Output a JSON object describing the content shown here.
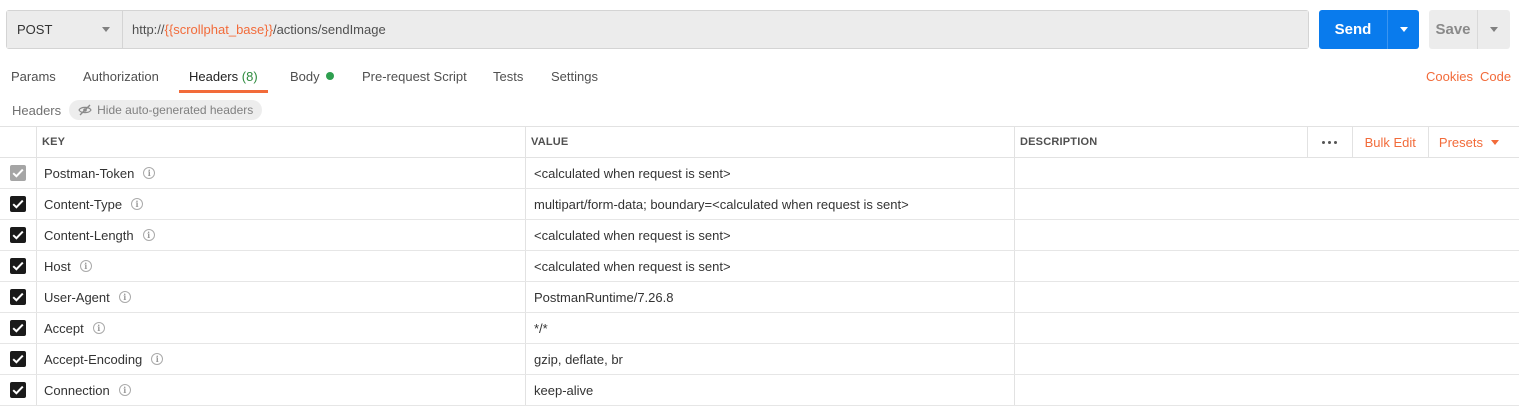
{
  "request": {
    "method": "POST",
    "url_prefix": "http://",
    "url_variable": "{{scrollphat_base}}",
    "url_suffix": "/actions/sendImage"
  },
  "buttons": {
    "send": "Send",
    "save": "Save"
  },
  "tabs": [
    {
      "label": "Params"
    },
    {
      "label": "Authorization"
    },
    {
      "label": "Headers",
      "count": "(8)"
    },
    {
      "label": "Body"
    },
    {
      "label": "Pre-request Script"
    },
    {
      "label": "Tests"
    },
    {
      "label": "Settings"
    }
  ],
  "links": {
    "cookies": "Cookies",
    "code": "Code"
  },
  "headers_section": {
    "title": "Headers",
    "hide_button": "Hide auto-generated headers"
  },
  "table": {
    "columns": {
      "key": "KEY",
      "value": "VALUE",
      "description": "DESCRIPTION"
    },
    "actions": {
      "bulk_edit": "Bulk Edit",
      "presets": "Presets"
    },
    "rows": [
      {
        "key": "Postman-Token",
        "value": "<calculated when request is sent>",
        "checked": true,
        "disabled": true
      },
      {
        "key": "Content-Type",
        "value": "multipart/form-data; boundary=<calculated when request is sent>",
        "checked": true
      },
      {
        "key": "Content-Length",
        "value": "<calculated when request is sent>",
        "checked": true
      },
      {
        "key": "Host",
        "value": "<calculated when request is sent>",
        "checked": true
      },
      {
        "key": "User-Agent",
        "value": "PostmanRuntime/7.26.8",
        "checked": true
      },
      {
        "key": "Accept",
        "value": "*/*",
        "checked": true
      },
      {
        "key": "Accept-Encoding",
        "value": "gzip, deflate, br",
        "checked": true
      },
      {
        "key": "Connection",
        "value": "keep-alive",
        "checked": true
      }
    ]
  },
  "colors": {
    "accent": "#f26b3a",
    "send": "#097bed",
    "count": "#2e8b3e",
    "body_dot": "#2e9f4f"
  }
}
